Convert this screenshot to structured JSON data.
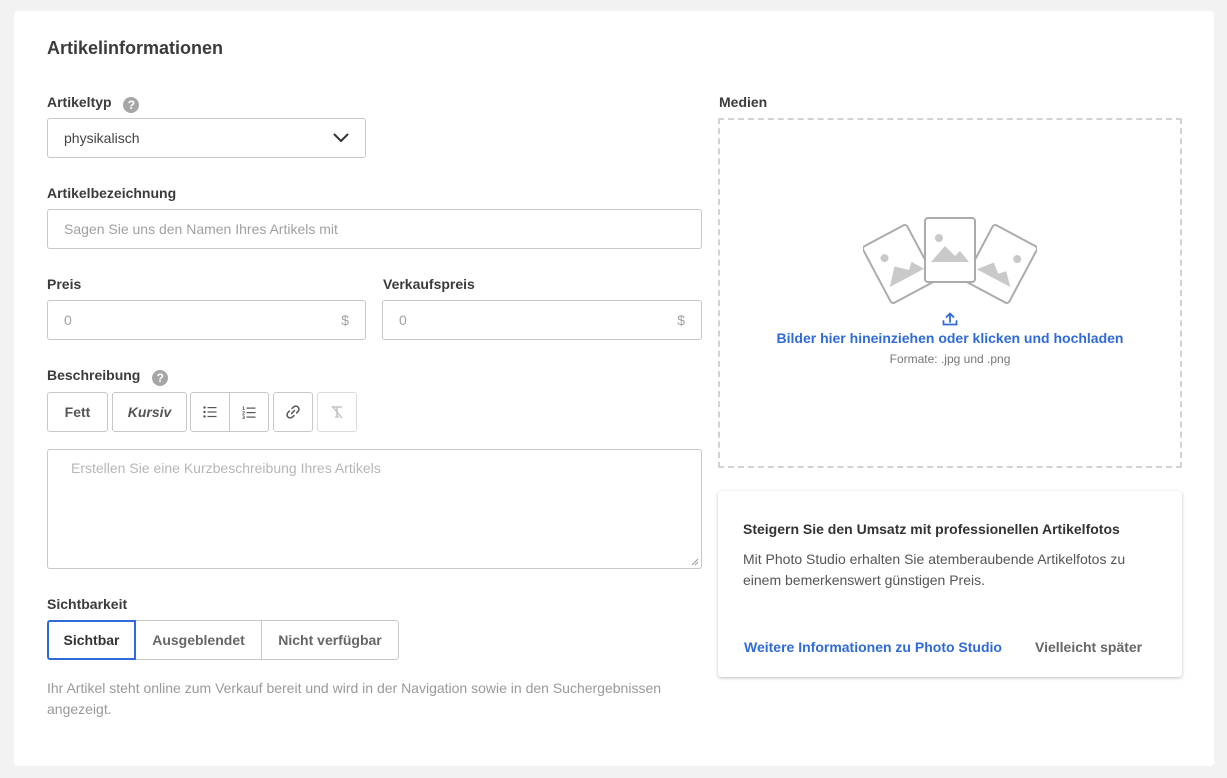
{
  "section": {
    "title": "Artikelinformationen"
  },
  "item_type": {
    "label": "Artikeltyp",
    "help": "?",
    "value": "physikalisch"
  },
  "item_name": {
    "label": "Artikelbezeichnung",
    "placeholder": "Sagen Sie uns den Namen Ihres Artikels mit"
  },
  "price": {
    "label": "Preis",
    "value": "0",
    "currency": "$"
  },
  "sale_price": {
    "label": "Verkaufspreis",
    "value": "0",
    "currency": "$"
  },
  "description": {
    "label": "Beschreibung",
    "help": "?",
    "toolbar": {
      "bold": "Fett",
      "italic": "Kursiv"
    },
    "placeholder": "Erstellen Sie eine Kurzbeschreibung Ihres Artikels"
  },
  "visibility": {
    "label": "Sichtbarkeit",
    "options": [
      "Sichtbar",
      "Ausgeblendet",
      "Nicht verfügbar"
    ],
    "selected": "Sichtbar",
    "hint": "Ihr Artikel steht online zum Verkauf bereit und wird in der Navigation sowie in den Suchergebnissen angezeigt."
  },
  "media": {
    "label": "Medien",
    "upload_text": "Bilder hier hineinziehen oder klicken und hochladen",
    "formats": "Formate: .jpg und .png"
  },
  "promo": {
    "title": "Steigern Sie den Umsatz mit professionellen Artikelfotos",
    "text": "Mit Photo Studio erhalten Sie atemberaubende Artikelfotos zu einem bemerkenswert günstigen Preis.",
    "learn_more": "Weitere Informationen zu Photo Studio",
    "dismiss": "Vielleicht später"
  },
  "colors": {
    "accent": "#2f6bd8",
    "border": "#c8c8c8",
    "text": "#3b3b3b"
  },
  "icons": [
    "help-icon",
    "chevron-down-icon",
    "bullet-list-icon",
    "numbered-list-icon",
    "link-icon",
    "clear-format-icon",
    "photos-illustration-icon",
    "upload-icon"
  ]
}
